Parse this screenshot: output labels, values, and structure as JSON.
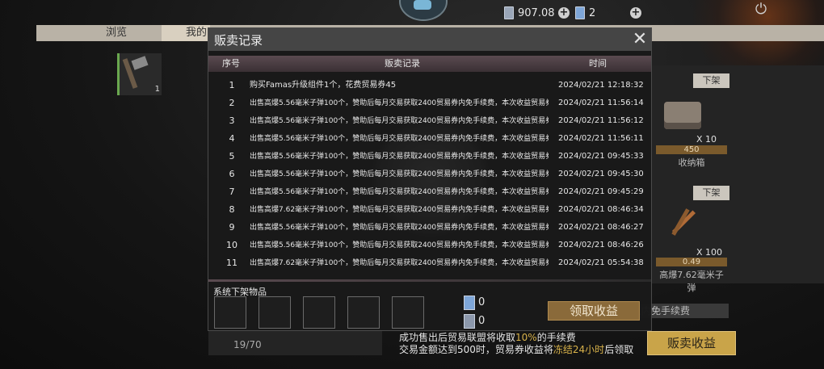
{
  "top": {
    "currency1": "907.08",
    "currency2": "2"
  },
  "tabs": [
    "浏览",
    "我的"
  ],
  "left_slot": {
    "qty": "1"
  },
  "right": {
    "shelf_label": "下架",
    "item1": {
      "qty": "X 10",
      "price": "450",
      "name": "收纳箱"
    },
    "item2": {
      "qty": "X 100",
      "price": "0.49",
      "name": "高爆7.62毫米子弹"
    },
    "fee_strip": "以内免手续费"
  },
  "bottom": {
    "counter": "19/70",
    "notice_line1_a": "成功售出后贸易联盟将收取",
    "notice_line1_hl": "10%",
    "notice_line1_b": "的手续费",
    "notice_line2_a": "交易金额达到500时，贸易券收益将",
    "notice_line2_hl": "冻结24小时",
    "notice_line2_b": "后领取",
    "sell_button": "贩卖收益"
  },
  "modal": {
    "title": "贩卖记录",
    "headers": {
      "index": "序号",
      "record": "贩卖记录",
      "time": "时间"
    },
    "rows": [
      {
        "index": "1",
        "record": "购买Famas升级组件1个，花费贸易券45",
        "time": "2024/02/21 12:18:32"
      },
      {
        "index": "2",
        "record": "出售高爆5.56毫米子弹100个，赞助后每月交易获取2400贸易券内免手续费，本次收益贸易券0.44",
        "time": "2024/02/21 11:56:14"
      },
      {
        "index": "3",
        "record": "出售高爆5.56毫米子弹100个，赞助后每月交易获取2400贸易券内免手续费，本次收益贸易券0.44",
        "time": "2024/02/21 11:56:12"
      },
      {
        "index": "4",
        "record": "出售高爆5.56毫米子弹100个，赞助后每月交易获取2400贸易券内免手续费，本次收益贸易券0.44",
        "time": "2024/02/21 11:56:11"
      },
      {
        "index": "5",
        "record": "出售高爆5.56毫米子弹100个，赞助后每月交易获取2400贸易券内免手续费，本次收益贸易券0.44",
        "time": "2024/02/21 09:45:33"
      },
      {
        "index": "6",
        "record": "出售高爆5.56毫米子弹100个，赞助后每月交易获取2400贸易券内免手续费，本次收益贸易券0.44",
        "time": "2024/02/21 09:45:30"
      },
      {
        "index": "7",
        "record": "出售高爆5.56毫米子弹100个，赞助后每月交易获取2400贸易券内免手续费，本次收益贸易券0.44",
        "time": "2024/02/21 09:45:29"
      },
      {
        "index": "8",
        "record": "出售高爆7.62毫米子弹100个，赞助后每月交易获取2400贸易券内免手续费，本次收益贸易券0.49",
        "time": "2024/02/21 08:46:34"
      },
      {
        "index": "9",
        "record": "出售高爆5.56毫米子弹100个，赞助后每月交易获取2400贸易券内免手续费，本次收益贸易券0.44",
        "time": "2024/02/21 08:46:27"
      },
      {
        "index": "10",
        "record": "出售高爆5.56毫米子弹100个，赞助后每月交易获取2400贸易券内免手续费，本次收益贸易券0.44",
        "time": "2024/02/21 08:46:26"
      },
      {
        "index": "11",
        "record": "出售高爆7.62毫米子弹100个，赞助后每月交易获取2400贸易券内免手续费，本次收益贸易券0.49",
        "time": "2024/02/21 05:54:38"
      }
    ],
    "system_label": "系统下架物品",
    "reward1": "0",
    "reward2": "0",
    "claim_button": "领取收益"
  }
}
